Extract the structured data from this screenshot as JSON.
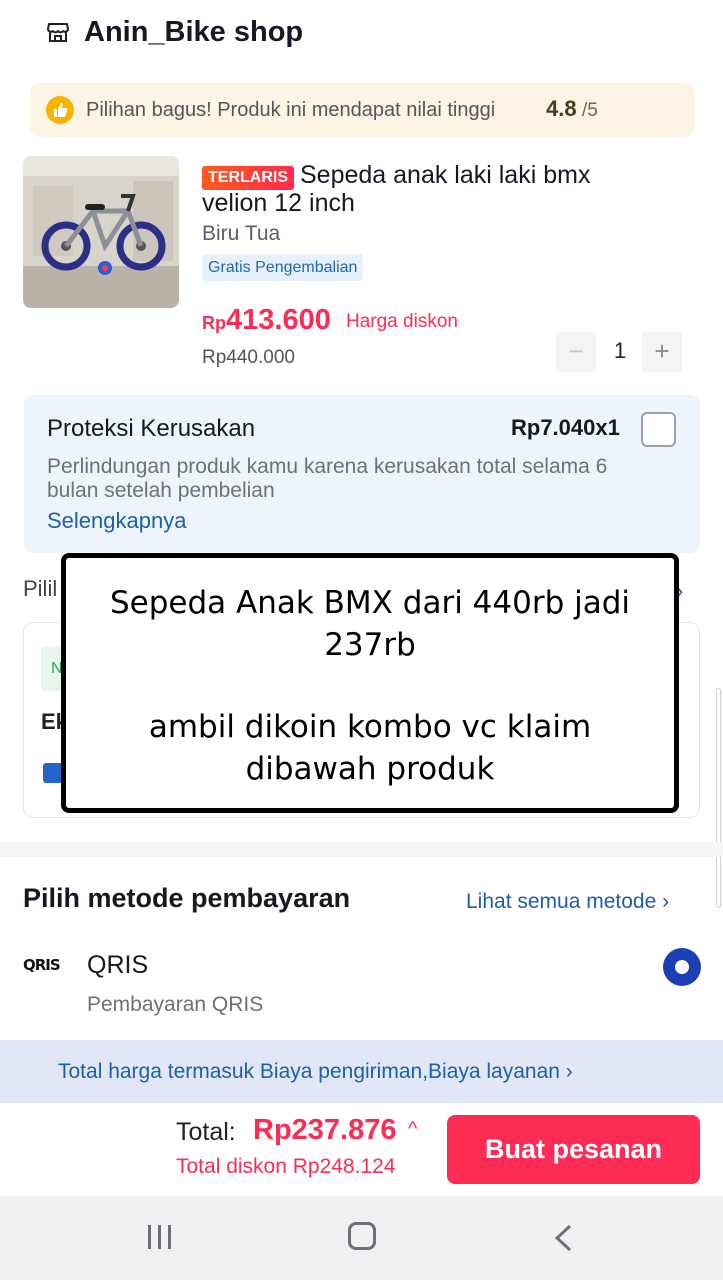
{
  "shop": {
    "name": "Anin_Bike shop",
    "icon": "store-icon"
  },
  "rating_banner": {
    "text": "Pilihan bagus! Produk ini mendapat nilai tinggi",
    "score": "4.8",
    "max": "/5",
    "icon": "thumbs-up-icon"
  },
  "product": {
    "badge": "TERLARIS",
    "title_line1": "Sepeda anak laki laki bmx",
    "title_line2": "velion 12 inch",
    "variant": "Biru Tua",
    "return_badge": "Gratis Pengembalian",
    "price_currency": "Rp",
    "price": "413.600",
    "price_label": "Harga diskon",
    "original_price": "Rp440.000",
    "quantity": "1",
    "qty_minus": "−",
    "qty_plus": "+"
  },
  "protection": {
    "title": "Proteksi Kerusakan",
    "price": "Rp7.040x1",
    "description": "Perlindungan produk kamu karena kerusakan total selama 6 bulan setelah pembelian",
    "link": "Selengkapnya"
  },
  "hidden_section": {
    "title_fragment": "Pilil",
    "card_chip": "N",
    "card_label": "Ek"
  },
  "overlay": {
    "line1": "Sepeda Anak BMX dari 440rb jadi",
    "line2": "237rb",
    "line3": "ambil dikoin kombo vc klaim",
    "line4": "dibawah produk"
  },
  "payment": {
    "title": "Pilih metode pembayaran",
    "see_all": "Lihat semua metode ›",
    "method_logo": "QRIS",
    "method_name": "QRIS",
    "method_sub": "Pembayaran QRIS"
  },
  "info_bar": {
    "text": "Total harga termasuk Biaya pengiriman,Biaya layanan  ›"
  },
  "footer": {
    "total_label": "Total:",
    "total_amount": "Rp237.876",
    "total_caret": "^",
    "discount": "Total diskon Rp248.124",
    "order_button": "Buat pesanan"
  },
  "colors": {
    "accent": "#fe2c55",
    "link": "#1d5fa8",
    "radio": "#1c3fb6"
  }
}
